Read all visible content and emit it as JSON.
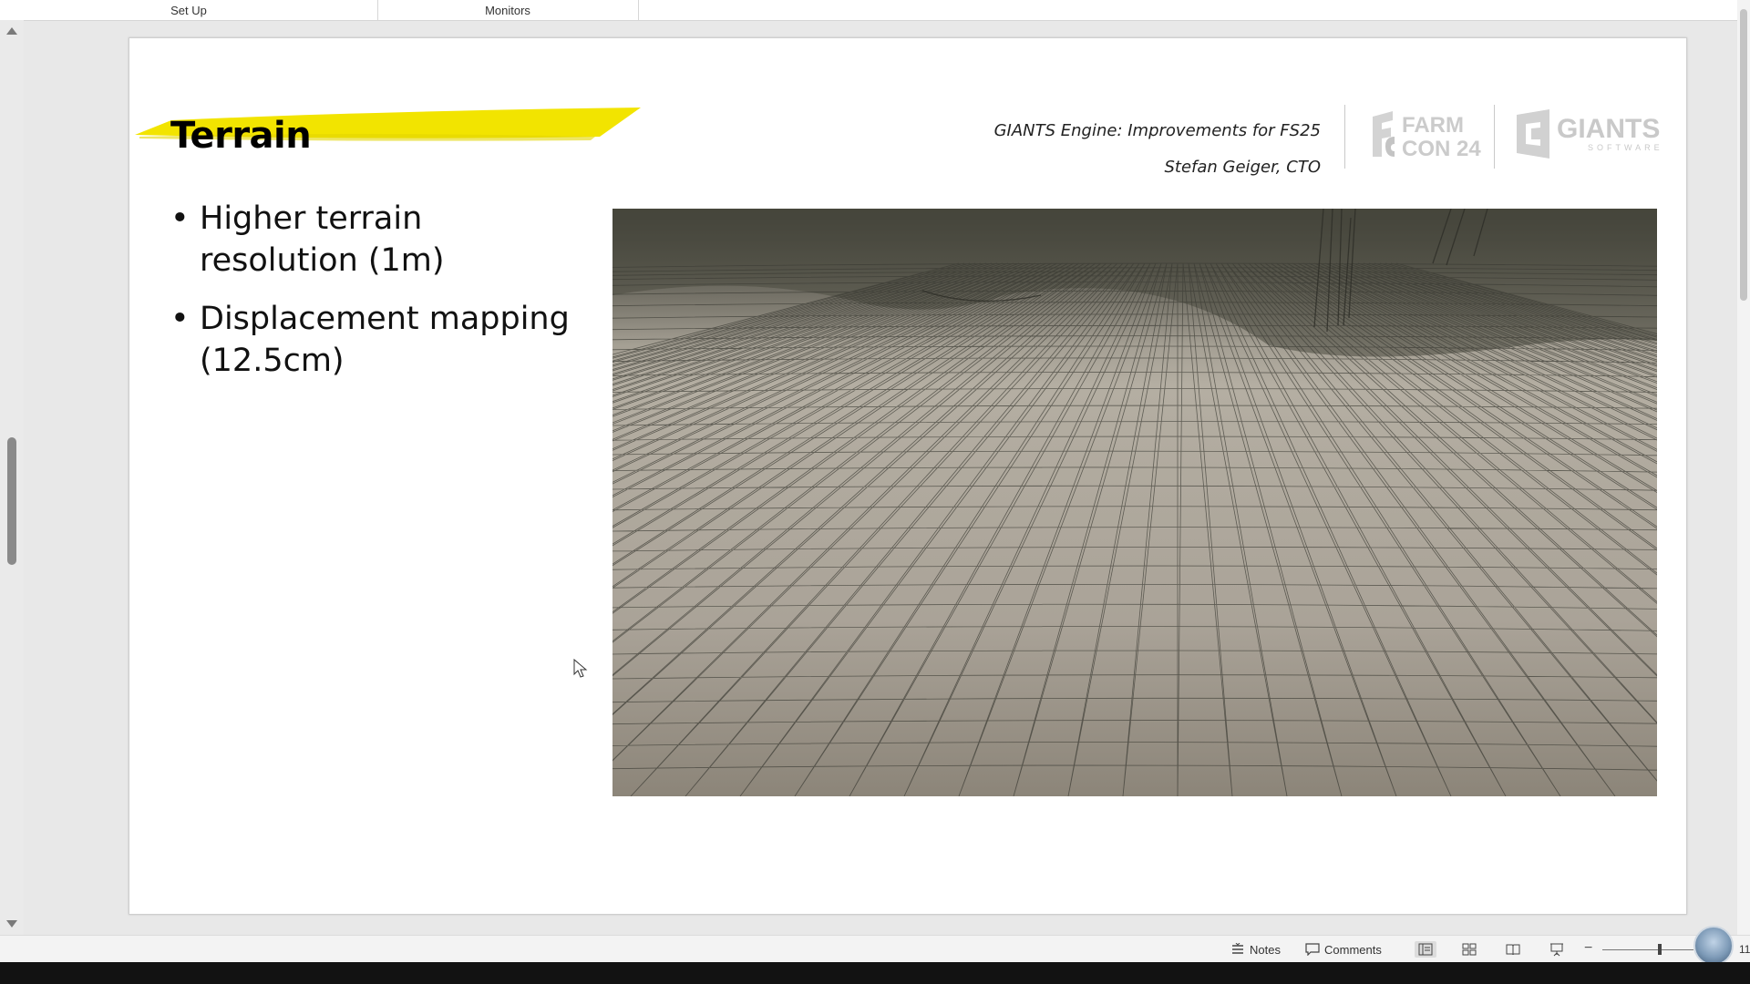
{
  "ribbon": {
    "groups": [
      "Set Up",
      "Monitors"
    ]
  },
  "slide": {
    "title": "Terrain",
    "header": {
      "line1": "GIANTS Engine: Improvements for FS25",
      "line2": "Stefan Geiger, CTO"
    },
    "logos": {
      "farmcon_top": "FARM",
      "farmcon_bottom": "CON 24",
      "giants_top": "GIANTS",
      "giants_bottom": "SOFTWARE"
    },
    "bullets": [
      "Higher terrain resolution (1m)",
      "Displacement mapping (12.5cm)"
    ],
    "accent_color": "#f2e400"
  },
  "statusbar": {
    "notes_label": "Notes",
    "comments_label": "Comments",
    "zoom_text": "11"
  }
}
